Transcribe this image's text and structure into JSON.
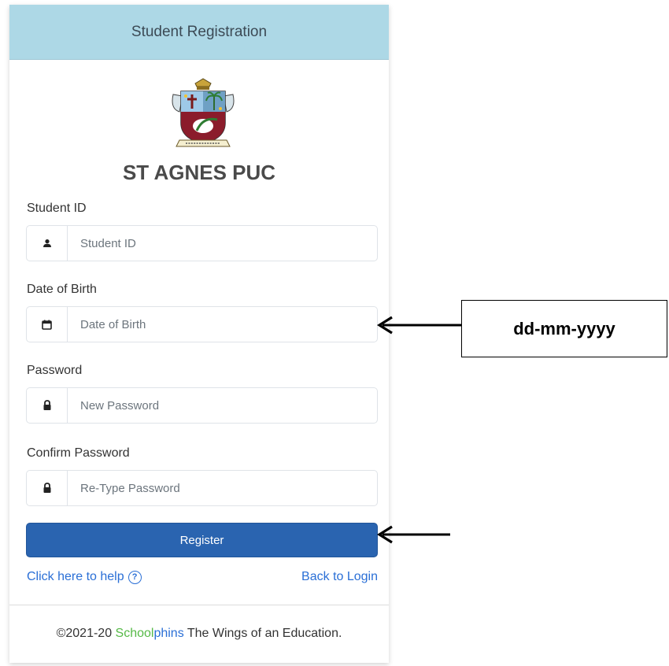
{
  "header": {
    "title": "Student Registration"
  },
  "school": {
    "name": "ST AGNES PUC"
  },
  "form": {
    "student_id": {
      "label": "Student ID",
      "placeholder": "Student ID",
      "icon": "user-icon"
    },
    "dob": {
      "label": "Date of Birth",
      "placeholder": "Date of Birth",
      "icon": "calendar-icon"
    },
    "password": {
      "label": "Password",
      "placeholder": "New Password",
      "icon": "lock-icon"
    },
    "confirm_password": {
      "label": "Confirm Password",
      "placeholder": "Re-Type Password",
      "icon": "lock-icon"
    },
    "register_label": "Register"
  },
  "links": {
    "help": "Click here to help",
    "help_icon": "question-circle-icon",
    "back_to_login": "Back to Login"
  },
  "footer": {
    "prefix": "©2021-20 ",
    "brand_green": "School",
    "brand_blue": "phins",
    "suffix": " The Wings of an Education."
  },
  "annotation": {
    "dob_format": "dd-mm-yyyy"
  },
  "colors": {
    "header_bg": "#add8e6",
    "button": "#2a64b0",
    "link": "#2a6fd6",
    "brand_green": "#56b947"
  }
}
